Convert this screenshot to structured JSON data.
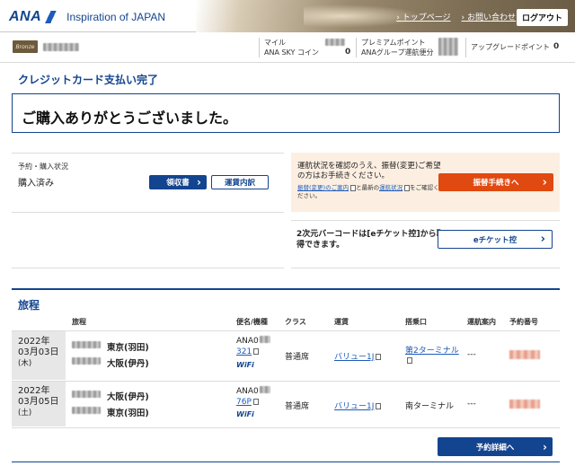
{
  "header": {
    "logo_text": "ANA",
    "tagline": "Inspiration of JAPAN",
    "links": [
      "トップページ",
      "お問い合わせ"
    ],
    "logout_label": "ログアウト"
  },
  "member_bar": {
    "miles_label_1": "マイル",
    "miles_label_2": "ANA SKY コイン",
    "skycoin_value": "0",
    "premium_label_1": "プレミアムポイント",
    "premium_label_2": "ANAグループ運航便分",
    "upgrade_label": "アップグレードポイント",
    "upgrade_value": "0"
  },
  "page": {
    "title": "クレジットカード支払い完了",
    "thanks": "ご購入ありがとうございました。"
  },
  "purchase": {
    "status_label": "予約・購入状況",
    "status_value": "購入済み",
    "receipt_button": "領収書",
    "fare_button": "運賃内訳"
  },
  "notice": {
    "text": "運航状況を確認のうえ、振替(変更)ご希望の方はお手続きください。",
    "small_link1": "振替(変更)のご案内",
    "small_mid": "と最新の",
    "small_link2": "運航状況",
    "small_end": "をご確認ください。",
    "button": "振替手続きへ"
  },
  "eticket": {
    "text": "2次元バーコードは[eチケット控]から取得できます。",
    "button": "eチケット控"
  },
  "itinerary": {
    "title": "旅程",
    "headers": [
      "旅程",
      "便名/機種",
      "クラス",
      "運賃",
      "搭乗口",
      "運航案内",
      "予約番号"
    ],
    "rows": [
      {
        "date_year": "2022年",
        "date_md": "03月03日",
        "date_dow": "(木)",
        "from": "東京(羽田)",
        "to": "大阪(伊丹)",
        "flight": "ANA0",
        "aircraft": "321",
        "wifi": "WiFi",
        "class": "普通席",
        "fare": "バリュー1J",
        "gate": "第2ターミナル",
        "status": "---"
      },
      {
        "date_year": "2022年",
        "date_md": "03月05日",
        "date_dow": "(土)",
        "from": "大阪(伊丹)",
        "to": "東京(羽田)",
        "flight": "ANA0",
        "aircraft": "76P",
        "wifi": "WiFi",
        "class": "普通席",
        "fare": "バリュー1J",
        "gate": "南ターミナル",
        "status": "---"
      }
    ],
    "detail_button": "予約詳細へ"
  },
  "colors": {
    "brand_navy": "#13448f",
    "accent_orange": "#e0490f",
    "notice_bg": "#fcefe2"
  }
}
